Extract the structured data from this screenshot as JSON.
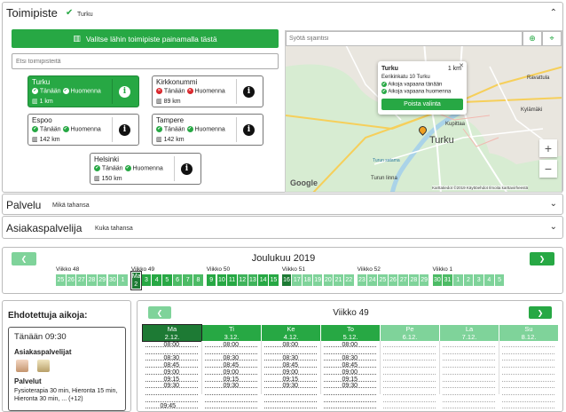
{
  "toimipiste": {
    "title": "Toimipiste",
    "selected_label": "Turku",
    "select_on_map_button": "Valitse lähin toimipiste painamalla tästä",
    "search_placeholder": "Etsi toimipisteitä",
    "locations": [
      {
        "name": "Turku",
        "today": "Tänään",
        "tomorrow": "Huomenna",
        "today_status": "ok",
        "tomorrow_status": "ok",
        "distance": "1 km",
        "selected": true
      },
      {
        "name": "Kirkkonummi",
        "today": "Tänään",
        "tomorrow": "Huomenna",
        "today_status": "no",
        "tomorrow_status": "no",
        "distance": "89 km",
        "selected": false
      },
      {
        "name": "Espoo",
        "today": "Tänään",
        "tomorrow": "Huomenna",
        "today_status": "ok",
        "tomorrow_status": "ok",
        "distance": "142 km",
        "selected": false
      },
      {
        "name": "Tampere",
        "today": "Tänään",
        "tomorrow": "Huomenna",
        "today_status": "ok",
        "tomorrow_status": "ok",
        "distance": "142 km",
        "selected": false
      },
      {
        "name": "Helsinki",
        "today": "Tänään",
        "tomorrow": "Huomenna",
        "today_status": "ok",
        "tomorrow_status": "ok",
        "distance": "150 km",
        "selected": false
      }
    ],
    "map": {
      "search_placeholder": "Syötä sijaintisi",
      "popup": {
        "name": "Turku",
        "distance": "1 km",
        "address": "Eerikinkatu 10 Turku",
        "line1": "Aikoja vapaana tänään",
        "line2": "Aikoja vapaana huomenna",
        "remove_button": "Poista valinta"
      },
      "labels": {
        "city": "Turku",
        "ravattula": "Ravattula",
        "kylamaki": "Kylämäki",
        "kupittaa": "Kupittaa",
        "turun_linna": "Turun linna",
        "turun_satama": "Turun satama",
        "google": "Google",
        "footer": "Karttatiedot ©2019   Käyttöehdot   Ilmoita karttavirheestä",
        "zoom_in": "+",
        "zoom_out": "−"
      }
    }
  },
  "palvelu": {
    "title": "Palvelu",
    "value": "Mikä tahansa"
  },
  "asiakaspalvelija": {
    "title": "Asiakaspalvelija",
    "value": "Kuka tahansa"
  },
  "calendar": {
    "month": "Joulukuu 2019",
    "prev": "❮",
    "next": "❯",
    "weeks": [
      {
        "label": "Viikko 48",
        "days": [
          "25",
          "26",
          "27",
          "28",
          "29",
          "30",
          "1"
        ]
      },
      {
        "label": "Viikko 49",
        "days": [
          "Ma 2",
          "3",
          "4",
          "5",
          "6",
          "7",
          "8"
        ]
      },
      {
        "label": "Viikko 50",
        "days": [
          "9",
          "10",
          "11",
          "12",
          "13",
          "14",
          "15"
        ]
      },
      {
        "label": "Viikko 51",
        "days": [
          "16",
          "17",
          "18",
          "19",
          "20",
          "21",
          "22"
        ]
      },
      {
        "label": "Viikko 52",
        "days": [
          "23",
          "24",
          "25",
          "26",
          "27",
          "28",
          "29"
        ]
      },
      {
        "label": "Viikko 1",
        "days": [
          "30",
          "31",
          "1",
          "2",
          "3",
          "4",
          "5"
        ]
      }
    ]
  },
  "suggested": {
    "title": "Ehdotettuja aikoja:",
    "time": "Tänään 09:30",
    "staff_label": "Asiakaspalvelijat",
    "services_label": "Palvelut",
    "services_text": "Fysioterapia 30 min, Hieronta 15 min, Hieronta 30 min, ... (+12)"
  },
  "week_view": {
    "title": "Viikko 49",
    "days": [
      {
        "name": "Ma",
        "date": "2.12.",
        "slots": [
          "08:00",
          "08:30",
          "08:45",
          "09:00",
          "09:15",
          "09:30",
          "09:45"
        ]
      },
      {
        "name": "Ti",
        "date": "3.12.",
        "slots": [
          "08:00",
          "08:30",
          "08:45",
          "09:00",
          "09:15",
          "09:30"
        ]
      },
      {
        "name": "Ke",
        "date": "4.12.",
        "slots": [
          "08:00",
          "08:30",
          "08:45",
          "09:00",
          "09:15",
          "09:30"
        ]
      },
      {
        "name": "To",
        "date": "5.12.",
        "slots": [
          "08:00",
          "08:30",
          "08:45",
          "09:00",
          "09:15",
          "09:30"
        ]
      },
      {
        "name": "Pe",
        "date": "6.12.",
        "slots": []
      },
      {
        "name": "La",
        "date": "7.12.",
        "slots": []
      },
      {
        "name": "Su",
        "date": "8.12.",
        "slots": []
      }
    ]
  },
  "colors": {
    "green": "#27a844",
    "light_green": "#7fd39a",
    "dark_green": "#1d7a34"
  }
}
